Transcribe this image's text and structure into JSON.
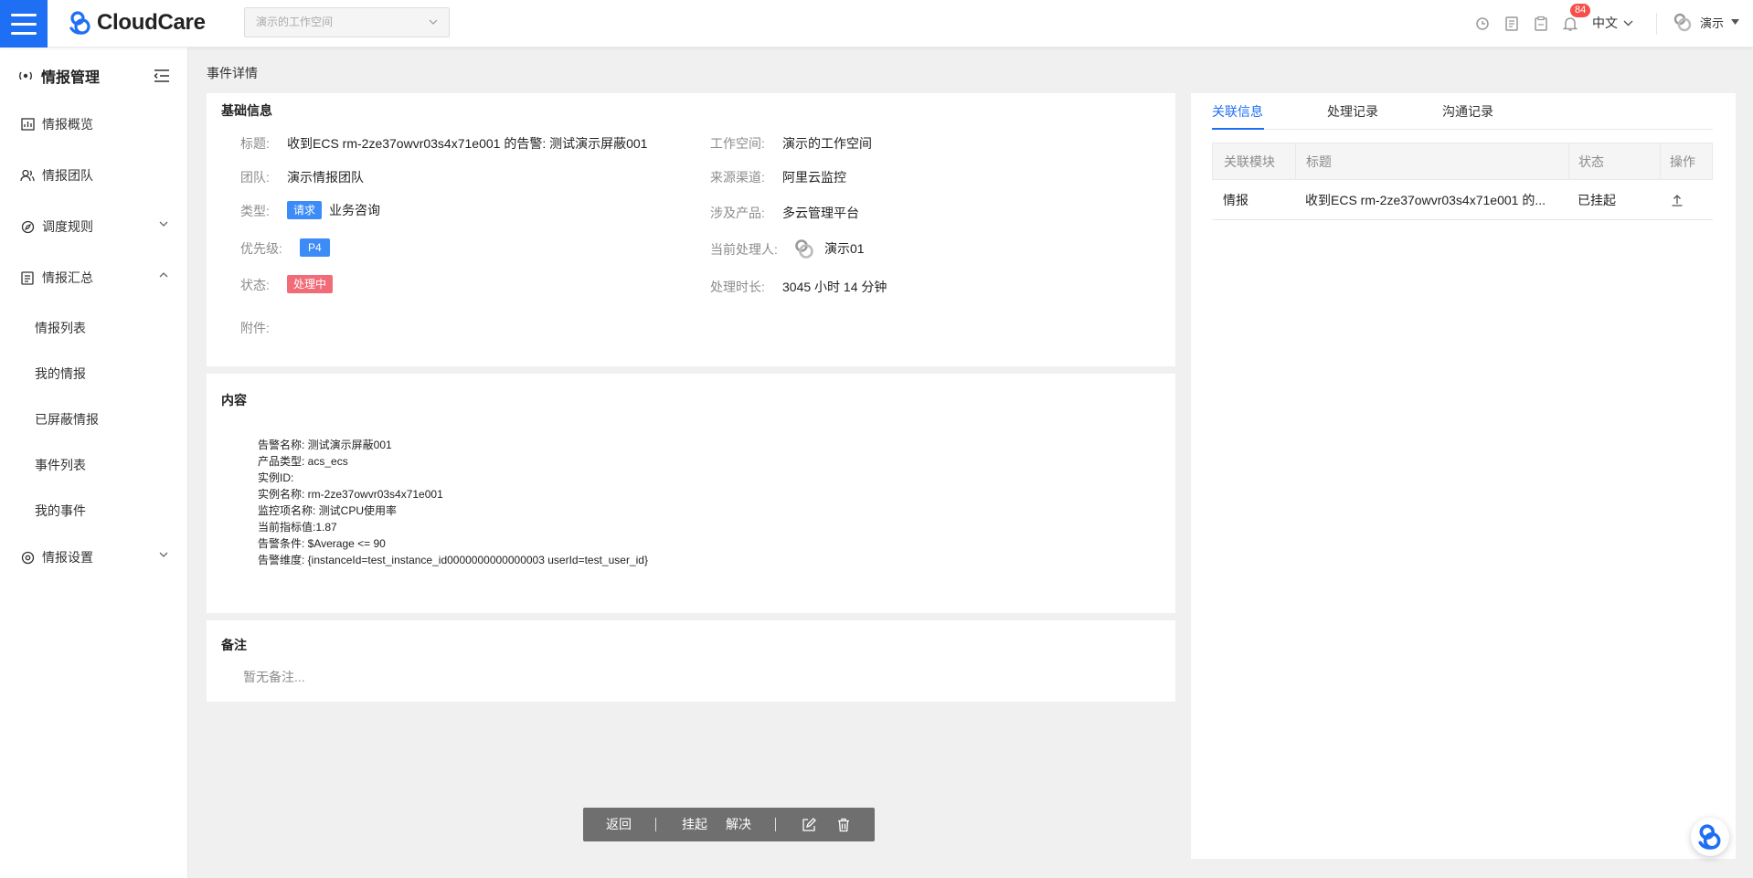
{
  "header": {
    "logo_text": "CloudCare",
    "workspace_placeholder": "演示的工作空间",
    "notification_count": "84",
    "language": "中文",
    "user_name": "演示"
  },
  "sidebar": {
    "title": "情报管理",
    "items": [
      {
        "label": "情报概览",
        "icon": "chart-icon"
      },
      {
        "label": "情报团队",
        "icon": "team-icon"
      },
      {
        "label": "调度规则",
        "icon": "compass-icon",
        "expanded": false
      },
      {
        "label": "情报汇总",
        "icon": "document-icon",
        "expanded": true
      },
      {
        "label": "情报设置",
        "icon": "settings-icon",
        "expanded": false
      }
    ],
    "sub_items": [
      "情报列表",
      "我的情报",
      "已屏蔽情报",
      "事件列表",
      "我的事件"
    ]
  },
  "breadcrumb": "事件详情",
  "basic_info": {
    "title": "基础信息",
    "fields": {
      "title_label": "标题:",
      "title_value": "收到ECS rm-2ze37owvr03s4x71e001 的告警: 测试演示屏蔽001",
      "workspace_label": "工作空间:",
      "workspace_value": "演示的工作空间",
      "team_label": "团队:",
      "team_value": "演示情报团队",
      "source_label": "来源渠道:",
      "source_value": "阿里云监控",
      "type_label": "类型:",
      "type_tag": "请求",
      "type_value": "业务咨询",
      "product_label": "涉及产品:",
      "product_value": "多云管理平台",
      "priority_label": "优先级:",
      "priority_tag": "P4",
      "handler_label": "当前处理人:",
      "handler_value": "演示01",
      "status_label": "状态:",
      "status_tag": "处理中",
      "duration_label": "处理时长:",
      "duration_value": "3045 小时 14 分钟",
      "attachment_label": "附件:"
    }
  },
  "content": {
    "title": "内容",
    "lines": [
      "告警名称: 测试演示屏蔽001",
      "产品类型: acs_ecs",
      "实例ID:",
      "实例名称: rm-2ze37owvr03s4x71e001",
      "监控项名称: 测试CPU使用率",
      "当前指标值:1.87",
      "告警条件: $Average <= 90",
      "告警维度: {instanceId=test_instance_id0000000000000003 userId=test_user_id}"
    ]
  },
  "remarks": {
    "title": "备注",
    "placeholder": "暂无备注..."
  },
  "right_panel": {
    "tabs": [
      "关联信息",
      "处理记录",
      "沟通记录"
    ],
    "active_tab": "关联信息",
    "columns": [
      "关联模块",
      "标题",
      "状态",
      "操作"
    ],
    "rows": [
      {
        "module": "情报",
        "title": "收到ECS rm-2ze37owvr03s4x71e001 的...",
        "status": "已挂起",
        "action_icon": "upload-icon"
      }
    ]
  },
  "action_bar": {
    "back": "返回",
    "suspend": "挂起",
    "resolve": "解决",
    "edit_icon": "edit-icon",
    "delete_icon": "trash-icon"
  },
  "colors": {
    "primary": "#1f6ff5",
    "tag_blue": "#3d8bf7",
    "tag_red": "#f16c78",
    "badge_red": "#f5504a"
  }
}
